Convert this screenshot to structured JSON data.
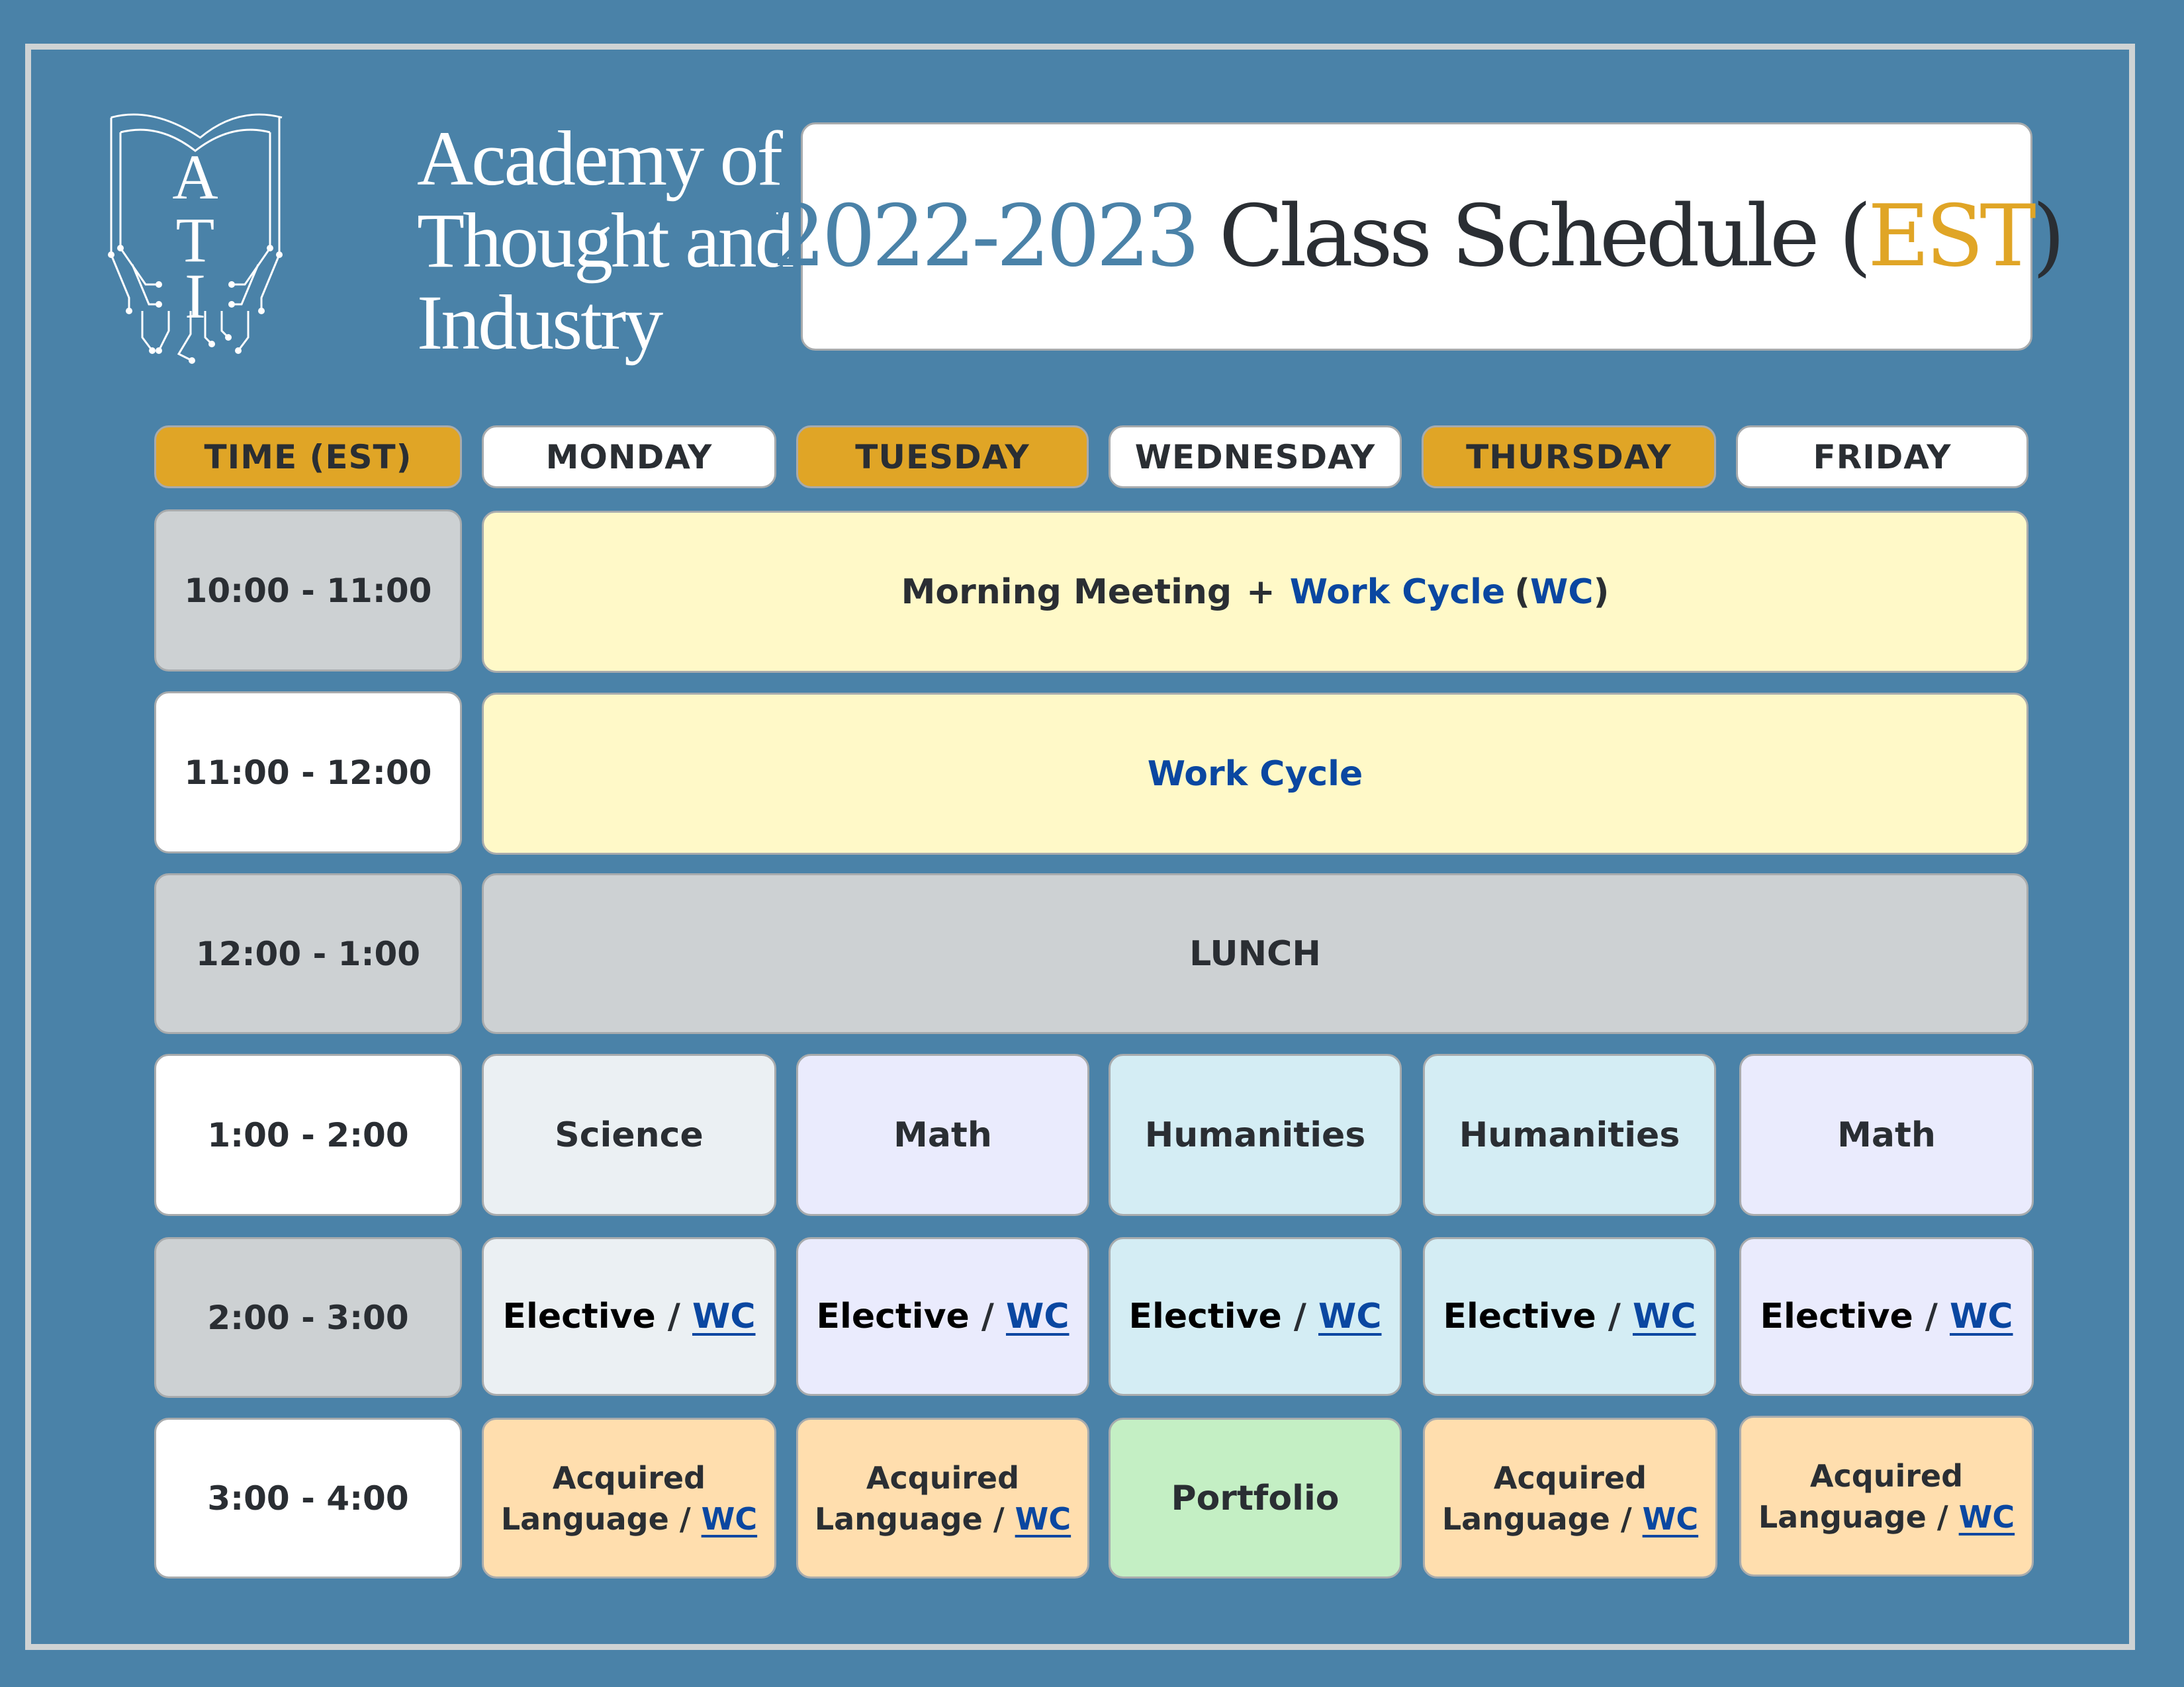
{
  "logo": {
    "monogram": [
      "A",
      "T",
      "I"
    ],
    "name_lines": [
      "Academy of",
      "Thought and",
      "Industry"
    ]
  },
  "title": {
    "years": "2022-2023",
    "text": "Class Schedule",
    "open_paren": "(",
    "tz": "EST",
    "close_paren": ")"
  },
  "colors": {
    "background": "#4a82a8",
    "accent_gold": "#e0a526",
    "link_blue": "#0a47a1",
    "work_cycle_yellow": "#fff9c8",
    "lunch_gray": "#cdd1d3",
    "science": "#ebf0f3",
    "math": "#eaebfd",
    "humanities": "#d4edf4",
    "language": "#ffdeae",
    "portfolio": "#c4efc4"
  },
  "header": {
    "time": "TIME (EST)",
    "days": [
      "MONDAY",
      "TUESDAY",
      "WEDNESDAY",
      "THURSDAY",
      "FRIDAY"
    ]
  },
  "times": [
    "10:00 - 11:00",
    "11:00 - 12:00",
    "12:00 - 1:00",
    "1:00 - 2:00",
    "2:00 - 3:00",
    "3:00 - 4:00"
  ],
  "rows": {
    "r1": {
      "part1": "Morning Meeting",
      "plus": "+",
      "part2": "Work Cycle",
      "paren_open": "(",
      "abbr": "WC",
      "paren_close": ")"
    },
    "r2": {
      "label": "Work Cycle"
    },
    "r3": {
      "label": "LUNCH"
    },
    "r4": [
      "Science",
      "Math",
      "Humanities",
      "Humanities",
      "Math"
    ],
    "r5": {
      "label": "Elective",
      "sep": "/",
      "link": "WC"
    },
    "r6": {
      "language_line1": "Acquired",
      "language_line2": "Language",
      "sep": "/",
      "link": "WC",
      "portfolio": "Portfolio"
    }
  }
}
